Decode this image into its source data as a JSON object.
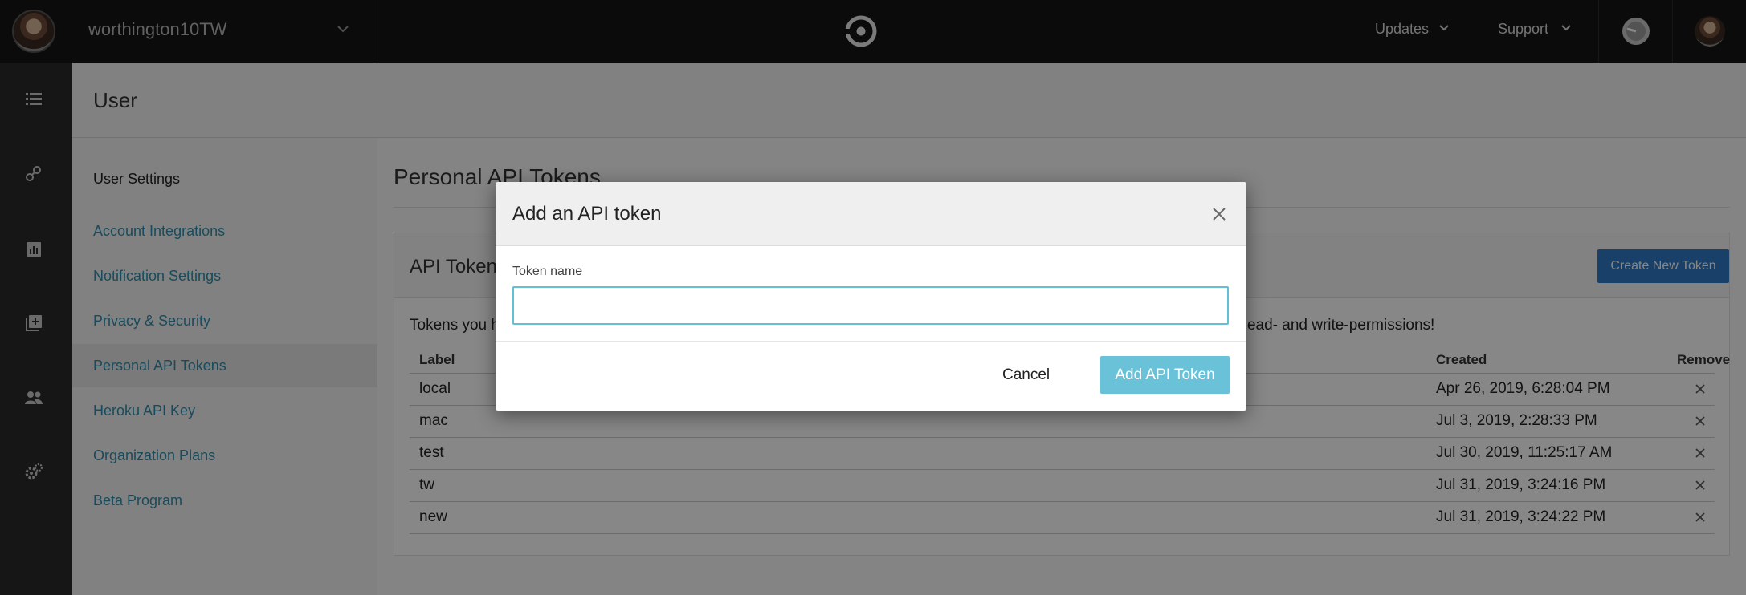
{
  "topbar": {
    "org_name": "worthington10TW",
    "updates_label": "Updates",
    "support_label": "Support"
  },
  "page": {
    "title": "User"
  },
  "subnav": {
    "heading": "User Settings",
    "items": [
      {
        "label": "Account Integrations"
      },
      {
        "label": "Notification Settings"
      },
      {
        "label": "Privacy & Security"
      },
      {
        "label": "Personal API Tokens",
        "active": true
      },
      {
        "label": "Heroku API Key"
      },
      {
        "label": "Organization Plans"
      },
      {
        "label": "Beta Program"
      }
    ]
  },
  "main": {
    "section_title": "Personal API Tokens",
    "card_title": "API Tokens",
    "create_button": "Create New Token",
    "description_start": "Tokens you h",
    "description_end": "ead- and write-permissions!",
    "table": {
      "columns": [
        "Label",
        "Created",
        "Remove"
      ],
      "rows": [
        {
          "label": "local",
          "created": "Apr 26, 2019, 6:28:04 PM"
        },
        {
          "label": "mac",
          "created": "Jul 3, 2019, 2:28:33 PM"
        },
        {
          "label": "test",
          "created": "Jul 30, 2019, 11:25:17 AM"
        },
        {
          "label": "tw",
          "created": "Jul 31, 2019, 3:24:16 PM"
        },
        {
          "label": "new",
          "created": "Jul 31, 2019, 3:24:22 PM"
        }
      ]
    }
  },
  "modal": {
    "title": "Add an API token",
    "field_label": "Token name",
    "field_value": "",
    "cancel_label": "Cancel",
    "submit_label": "Add API Token"
  },
  "colors": {
    "topbar_bg": "#161616",
    "rail_bg": "#2b2b2b",
    "link": "#2e8fae",
    "primary_button": "#2f79c4",
    "modal_submit": "#69c2d7",
    "input_focus_border": "#62c0d5"
  },
  "icons": {
    "rail": [
      "list-icon",
      "workflow-icon",
      "insights-icon",
      "add-project-icon",
      "team-icon",
      "settings-icon"
    ]
  }
}
